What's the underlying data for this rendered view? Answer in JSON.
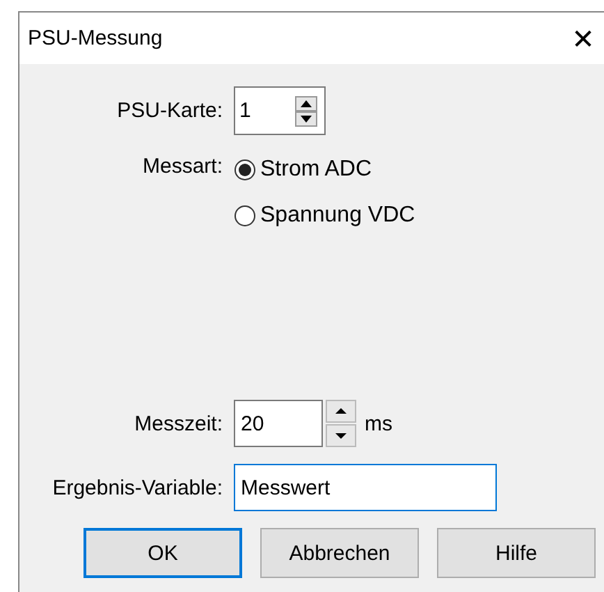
{
  "window": {
    "title": "PSU-Messung",
    "close": "✕"
  },
  "psu_card": {
    "label": "PSU-Karte:",
    "value": "1"
  },
  "measure_type": {
    "label": "Messart:",
    "options": [
      {
        "label": "Strom ADC",
        "selected": true
      },
      {
        "label": "Spannung VDC",
        "selected": false
      }
    ]
  },
  "measure_time": {
    "label": "Messzeit:",
    "value": "20",
    "unit": "ms"
  },
  "result_variable": {
    "label": "Ergebnis-Variable:",
    "value": "Messwert",
    "focused": true
  },
  "buttons": [
    {
      "label": "OK",
      "default": true
    },
    {
      "label": "Abbrechen",
      "default": false
    },
    {
      "label": "Hilfe",
      "default": false
    }
  ]
}
